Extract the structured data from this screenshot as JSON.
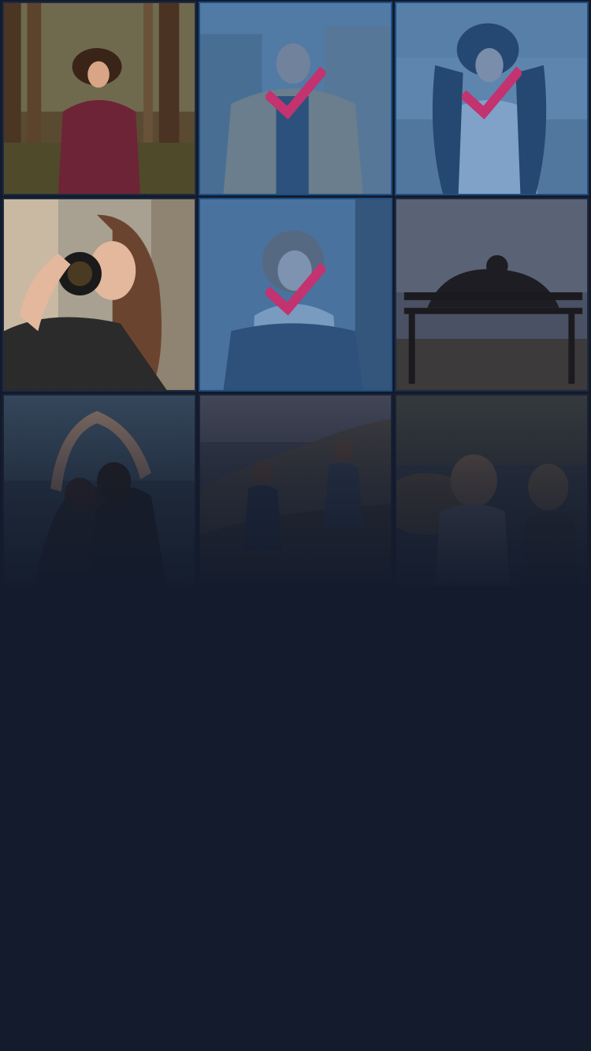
{
  "gallery": {
    "accent_overlay": "#2c6eb4",
    "check_color": "#c2336f",
    "background": "#131b2c",
    "photos": [
      {
        "subject": "woman-in-forest",
        "selected": false
      },
      {
        "subject": "man-in-blazer-city",
        "selected": true
      },
      {
        "subject": "woman-street-traffic",
        "selected": true
      },
      {
        "subject": "woman-with-camera",
        "selected": false
      },
      {
        "subject": "woman-with-scarf",
        "selected": true
      },
      {
        "subject": "people-on-bench",
        "selected": false
      },
      {
        "subject": "couple-heart-hands",
        "selected": false
      },
      {
        "subject": "friends-on-rocks",
        "selected": false
      },
      {
        "subject": "friends-at-sunset",
        "selected": false
      }
    ]
  }
}
